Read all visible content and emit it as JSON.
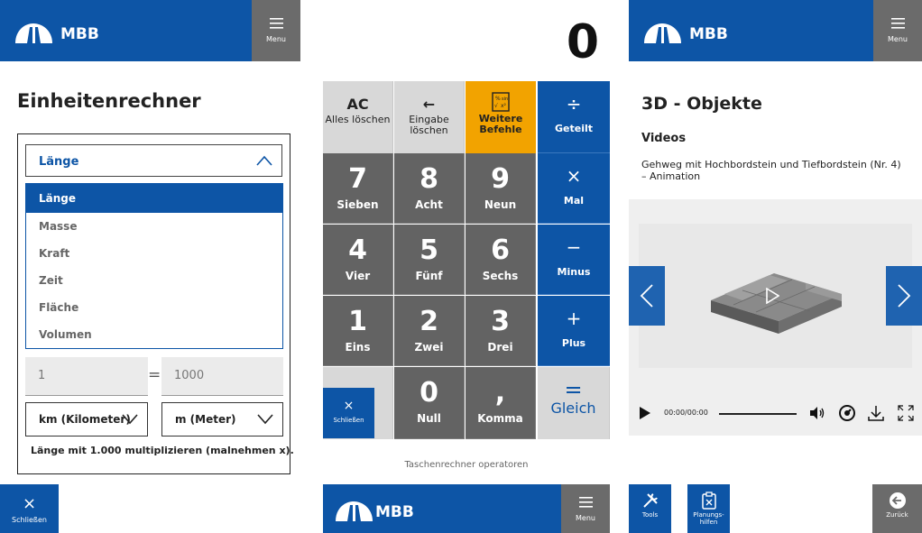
{
  "brand": {
    "name": "MBB",
    "color": "#0d55a6"
  },
  "menu_label": "Menu",
  "converter": {
    "title": "Einheitenrechner",
    "category_selected": "Länge",
    "options": [
      "Länge",
      "Masse",
      "Kraft",
      "Zeit",
      "Fläche",
      "Volumen"
    ],
    "input_value": "1",
    "equals": "=",
    "result_value": "1000",
    "from_unit": "km (Kilometer)",
    "to_unit": "m (Meter)",
    "hint": "Länge mit 1.000 multiplizieren (malnehmen x).",
    "close_label": "Schließen"
  },
  "calculator": {
    "display": "0",
    "keys": {
      "ac": {
        "top": "AC",
        "label": "Alles löschen"
      },
      "back": {
        "top": "←",
        "label": "Eingabe löschen"
      },
      "more": {
        "label": "Weitere Befehle"
      },
      "div": {
        "top": "÷",
        "label": "Geteilt"
      },
      "k7": {
        "top": "7",
        "label": "Sieben"
      },
      "k8": {
        "top": "8",
        "label": "Acht"
      },
      "k9": {
        "top": "9",
        "label": "Neun"
      },
      "mul": {
        "top": "×",
        "label": "Mal"
      },
      "k4": {
        "top": "4",
        "label": "Vier"
      },
      "k5": {
        "top": "5",
        "label": "Fünf"
      },
      "k6": {
        "top": "6",
        "label": "Sechs"
      },
      "minus": {
        "top": "−",
        "label": "Minus"
      },
      "k1": {
        "top": "1",
        "label": "Eins"
      },
      "k2": {
        "top": "2",
        "label": "Zwei"
      },
      "k3": {
        "top": "3",
        "label": "Drei"
      },
      "plus": {
        "top": "+",
        "label": "Plus"
      },
      "k0": {
        "top": "0",
        "label": "Null"
      },
      "comma": {
        "top": ",",
        "label": "Komma"
      },
      "eq": {
        "top": "=",
        "label": "Gleich"
      }
    },
    "close_label": "Schließen",
    "footer": "Taschenrechner operatoren"
  },
  "objects": {
    "title": "3D - Objekte",
    "section": "Videos",
    "video_title": "Gehweg mit Hochbordstein und Tiefbordstein (Nr. 4) – Animation",
    "time": "00:00/00:00",
    "tools_label": "Tools",
    "planning_label": "Planungs-\nhilfen",
    "back_label": "Zurück"
  }
}
